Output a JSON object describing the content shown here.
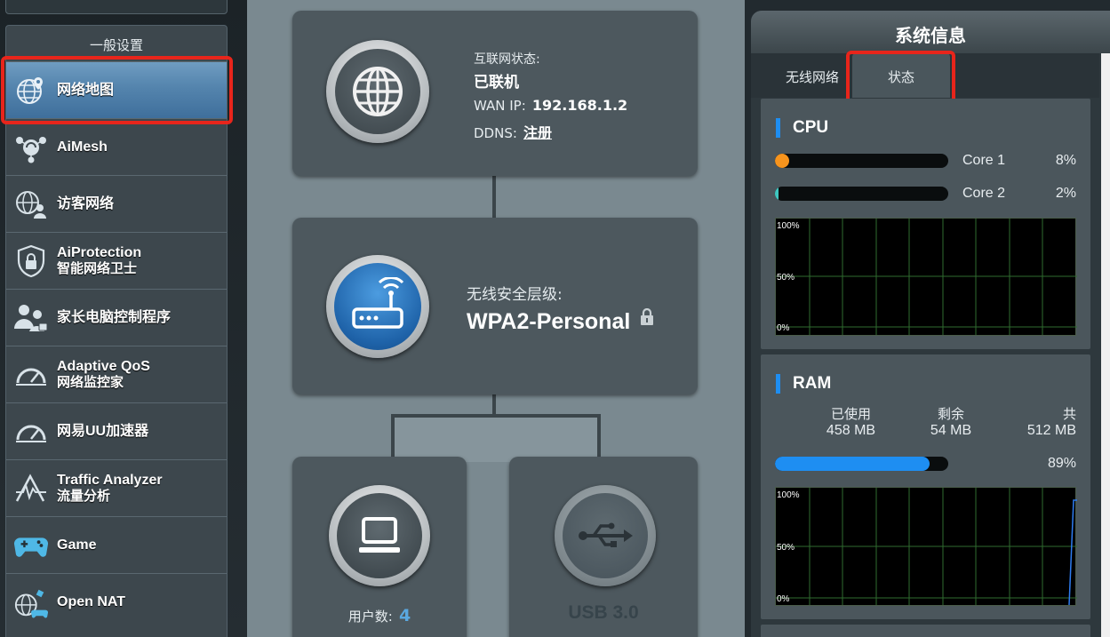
{
  "sidebar": {
    "header": "一般设置",
    "items": [
      {
        "label": "网络地图",
        "sub": ""
      },
      {
        "label": "AiMesh",
        "sub": ""
      },
      {
        "label": "访客网络",
        "sub": ""
      },
      {
        "label": "AiProtection",
        "sub": "智能网络卫士"
      },
      {
        "label": "家长电脑控制程序",
        "sub": ""
      },
      {
        "label": "Adaptive QoS",
        "sub": "网络监控家"
      },
      {
        "label": "网易UU加速器",
        "sub": ""
      },
      {
        "label": "Traffic Analyzer",
        "sub": "流量分析"
      },
      {
        "label": "Game",
        "sub": ""
      },
      {
        "label": "Open NAT",
        "sub": ""
      }
    ]
  },
  "internet": {
    "status_label": "互联网状态:",
    "status_value": "已联机",
    "wan_label": "WAN IP:",
    "wan_value": "192.168.1.2",
    "ddns_label": "DDNS:",
    "ddns_value": "注册"
  },
  "wireless": {
    "security_label": "无线安全层级:",
    "security_value": "WPA2-Personal"
  },
  "clients": {
    "label": "用户数:",
    "count": "4"
  },
  "usb": {
    "label": "USB 3.0"
  },
  "system_panel": {
    "title": "系统信息",
    "tabs": [
      "无线网络",
      "状态"
    ],
    "cpu": {
      "title": "CPU",
      "cores": [
        {
          "name": "Core 1",
          "percent": "8%",
          "value": 8,
          "color": "#f7941d"
        },
        {
          "name": "Core 2",
          "percent": "2%",
          "value": 2,
          "color": "#3fc7c0"
        }
      ],
      "graph_labels": [
        "100%",
        "50%",
        "0%"
      ]
    },
    "ram": {
      "title": "RAM",
      "used_label": "已使用",
      "used_value": "458 MB",
      "free_label": "剩余",
      "free_value": "54 MB",
      "total_label": "共",
      "total_value": "512 MB",
      "percent": "89%",
      "value": 89,
      "color": "#1e8ef2",
      "graph_labels": [
        "100%",
        "50%",
        "0%"
      ]
    }
  },
  "colors": {
    "accent": "#1e8ef2",
    "highlight": "#e8251b",
    "link_blue": "#5aa8e0"
  }
}
